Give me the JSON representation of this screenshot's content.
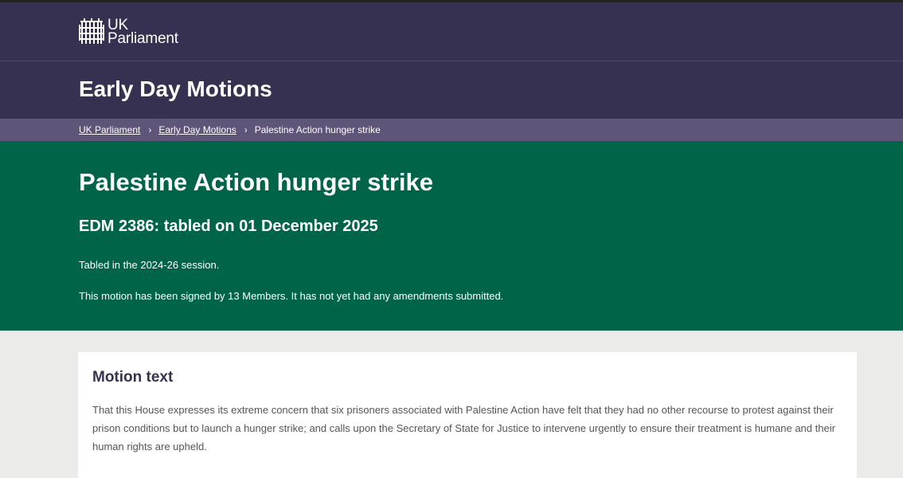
{
  "logo": {
    "line1": "UK",
    "line2": "Parliament",
    "icon": "portcullis-icon"
  },
  "header": {
    "section_title": "Early Day Motions"
  },
  "breadcrumb": {
    "items": [
      {
        "label": "UK Parliament"
      },
      {
        "label": "Early Day Motions"
      },
      {
        "label": "Palestine Action hunger strike"
      }
    ],
    "separator": ">"
  },
  "hero": {
    "title": "Palestine Action hunger strike",
    "subtitle": "EDM 2386: tabled on 01 December 2025",
    "session": "Tabled in the 2024-26 session.",
    "signatures": "This motion has been signed by 13 Members. It has not yet had any amendments submitted."
  },
  "motion": {
    "heading": "Motion text",
    "text": "That this House expresses its extreme concern that six prisoners associated with Palestine Action have felt that they had no other recourse to protest against their prison conditions but to launch a hunger strike; and calls upon the Secretary of State for Justice to intervene urgently to ensure their treatment is humane and their human rights are upheld."
  },
  "colors": {
    "header_bg": "#373151",
    "breadcrumb_bg": "#5e5578",
    "hero_bg": "#006548",
    "page_bg": "#ebebe9",
    "heading_text": "#373151"
  }
}
